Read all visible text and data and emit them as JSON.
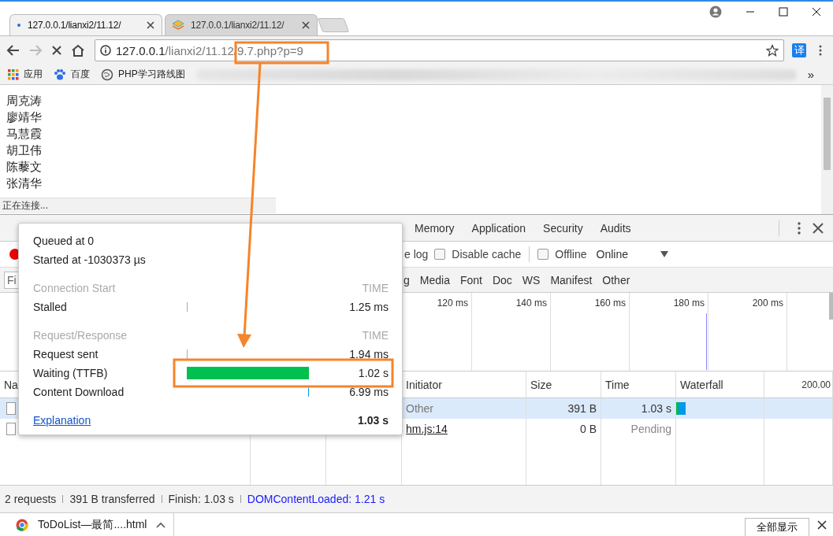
{
  "browser_tabs": [
    {
      "title": "127.0.0.1/lianxi2/11.12/",
      "selected": true
    },
    {
      "title": "127.0.0.1/lianxi2/11.12/",
      "selected": false
    }
  ],
  "address": {
    "host": "127.0.0.1",
    "path": "/lianxi2/11.12/9.7.php?p=9"
  },
  "extension_label": "译",
  "bookmarks": [
    {
      "kind": "apps",
      "label": "应用"
    },
    {
      "kind": "paw",
      "label": "百度"
    },
    {
      "kind": "globe",
      "label": "PHP学习路线图"
    }
  ],
  "bookmarks_more": "»",
  "page": {
    "names": [
      "周克涛",
      "廖靖华",
      "马慧霞",
      "胡卫伟",
      "陈藜文",
      "张清华"
    ],
    "status": "正在连接..."
  },
  "devtools": {
    "tabs": [
      "Memory",
      "Application",
      "Security",
      "Audits"
    ],
    "toolbar": {
      "preserve_log_partial": "e log",
      "options": [
        {
          "label": "Disable cache",
          "checked": false
        },
        {
          "label": "Offline",
          "checked": false
        }
      ],
      "throttle": "Online"
    },
    "filter": {
      "placeholder": "Fi",
      "types_partial": "g",
      "types": [
        "Media",
        "Font",
        "Doc",
        "WS",
        "Manifest",
        "Other"
      ]
    },
    "overview_ticks": [
      "120 ms",
      "140 ms",
      "160 ms",
      "180 ms",
      "200 ms"
    ],
    "table": {
      "columns": {
        "name_partial": "Na",
        "initiator": "Initiator",
        "size": "Size",
        "time": "Time",
        "waterfall": "Waterfall",
        "waterfall_scale": "200.00"
      },
      "rows": [
        {
          "initiator": "Other",
          "link": false,
          "size": "391 B",
          "time": "1.03 s",
          "pending": false,
          "selected": true
        },
        {
          "initiator": "hm.js:14",
          "link": true,
          "size": "0 B",
          "time": "Pending",
          "pending": true,
          "selected": false
        }
      ]
    },
    "status_bar": [
      {
        "text": "2 requests",
        "kind": "plain"
      },
      {
        "text": "391 B transferred",
        "kind": "plain"
      },
      {
        "text": "Finish: 1.03 s",
        "kind": "plain"
      },
      {
        "text": "DOMContentLoaded: 1.21 s",
        "kind": "dom"
      }
    ]
  },
  "timing_popup": {
    "lines": [
      "Queued at 0",
      "Started at -1030373 µs"
    ],
    "sections": [
      {
        "title": "Connection Start",
        "time_label": "TIME",
        "rows": [
          {
            "label": "Stalled",
            "value": "1.25 ms",
            "kind": "start-tick"
          }
        ]
      },
      {
        "title": "Request/Response",
        "time_label": "TIME",
        "rows": [
          {
            "label": "Request sent",
            "value": "1.94 ms",
            "kind": "start-tick"
          },
          {
            "label": "Waiting (TTFB)",
            "value": "1.02 s",
            "kind": "bar"
          },
          {
            "label": "Content Download",
            "value": "6.99 ms",
            "kind": "end-tick"
          }
        ]
      }
    ],
    "explanation": "Explanation",
    "total": "1.03 s"
  },
  "download_bar": {
    "file": "ToDoList—最简....html",
    "show_all": "全部显示"
  }
}
